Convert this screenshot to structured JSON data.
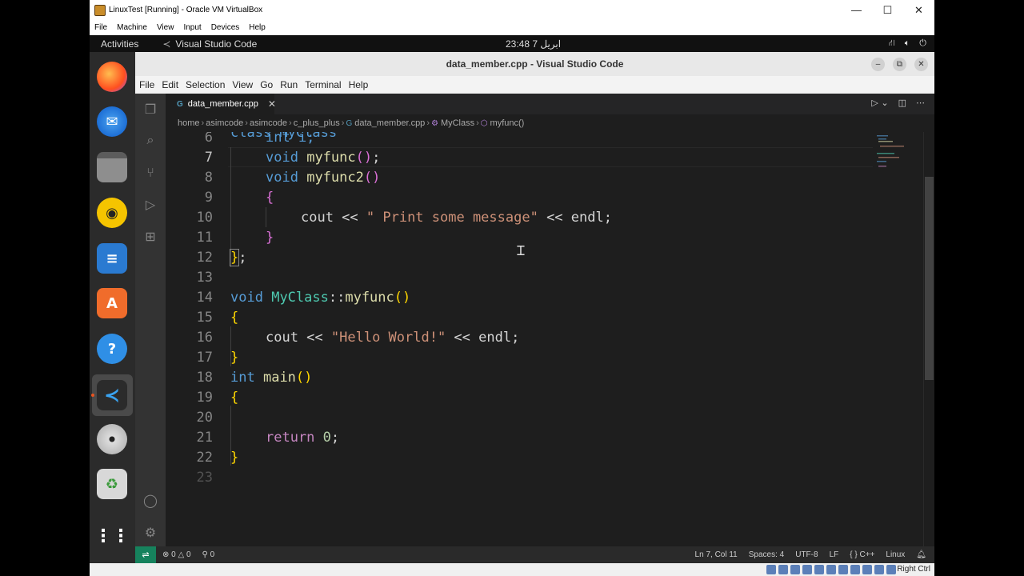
{
  "virtualbox": {
    "title": "LinuxTest [Running] - Oracle VM VirtualBox",
    "menu": [
      "File",
      "Machine",
      "View",
      "Input",
      "Devices",
      "Help"
    ],
    "host_key": "Right Ctrl"
  },
  "gnome": {
    "activities": "Activities",
    "app_name": "Visual Studio Code",
    "clock": "23:48  7 ابریل"
  },
  "vscode": {
    "title": "data_member.cpp - Visual Studio Code",
    "menu": [
      "File",
      "Edit",
      "Selection",
      "View",
      "Go",
      "Run",
      "Terminal",
      "Help"
    ],
    "tab": "data_member.cpp",
    "breadcrumbs": [
      "home",
      "asimcode",
      "asimcode",
      "c_plus_plus",
      "data_member.cpp",
      "MyClass",
      "myfunc()"
    ],
    "status": {
      "errors": "0",
      "warnings": "0",
      "ports": "0",
      "position": "Ln 7, Col 11",
      "spaces": "Spaces: 4",
      "encoding": "UTF-8",
      "eol": "LF",
      "language": "C++",
      "os": "Linux"
    },
    "line_numbers": [
      "6",
      "7",
      "8",
      "9",
      "10",
      "11",
      "12",
      "13",
      "14",
      "15",
      "16",
      "17",
      "18",
      "19",
      "20",
      "21",
      "22",
      "23"
    ],
    "code": {
      "l5": "class MyClass",
      "l6": "int i;",
      "l7_kw": "void",
      "l7_fn": "myfunc",
      "l7_rest": ";",
      "l8_kw": "void",
      "l8_fn": "myfunc2",
      "l10_a": "cout << ",
      "l10_str": "\" Print some message\"",
      "l10_b": " << endl;",
      "l12": ";",
      "l14_kw": "void",
      "l14_cls": "MyClass",
      "l14_sep": "::",
      "l14_fn": "myfunc",
      "l16_a": "cout << ",
      "l16_str": "\"Hello World!\"",
      "l16_b": " << endl;",
      "l18_kw": "int",
      "l18_fn": "main",
      "l21_kw": "return",
      "l21_num": "0",
      "l21_end": ";"
    }
  }
}
